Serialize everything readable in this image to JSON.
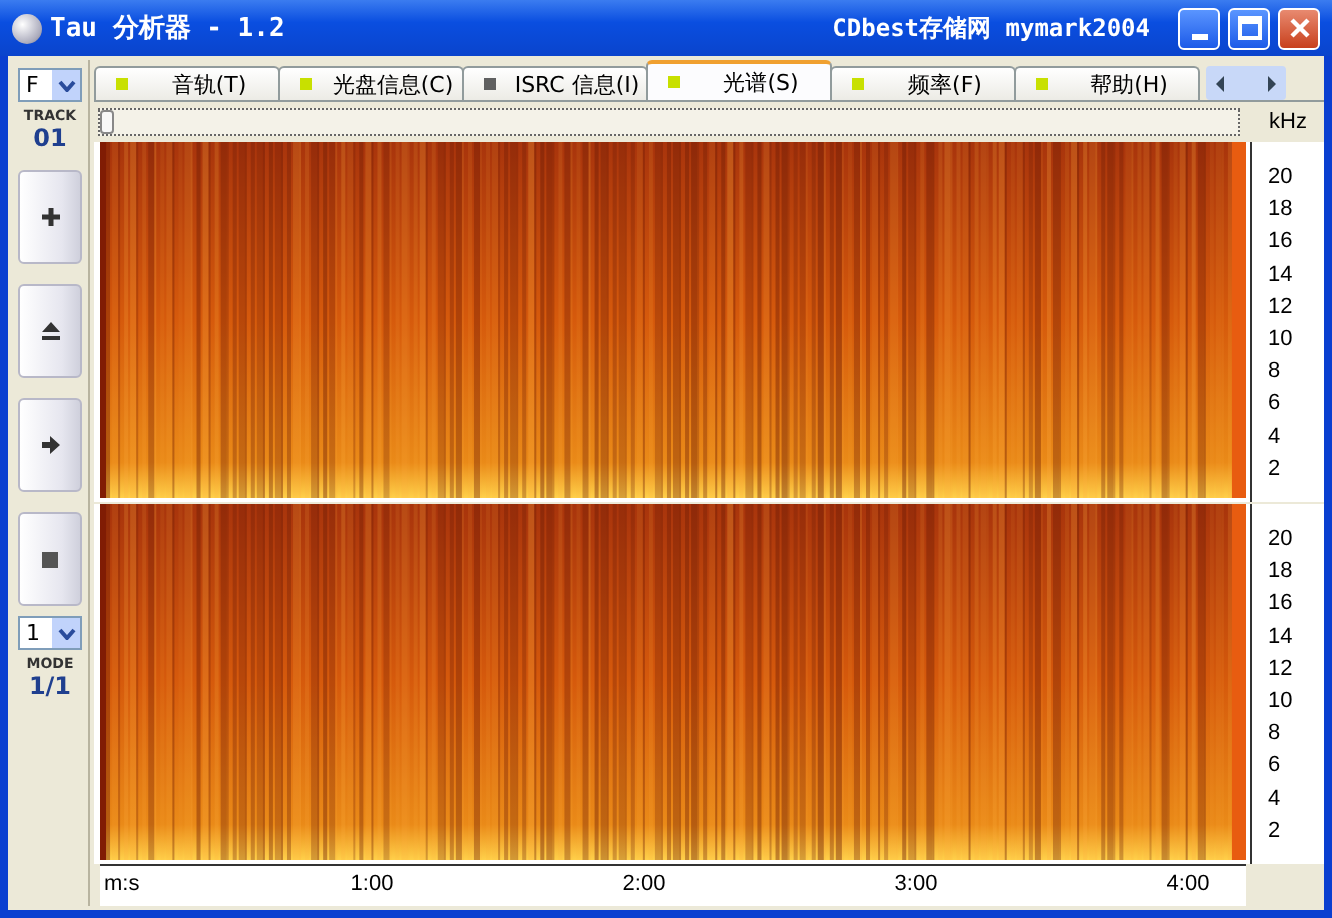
{
  "window": {
    "title": "Tau 分析器 - 1.2",
    "subtitle": "CDbest存储网 mymark2004"
  },
  "left_panel": {
    "drive": "F",
    "track_label": "TRACK",
    "track": "01",
    "mode_select": "1",
    "mode_label": "MODE",
    "mode": "1/1"
  },
  "tabs": [
    {
      "label": "音轨(T)",
      "selected": false,
      "color": "#c8e000"
    },
    {
      "label": "光盘信息(C)",
      "selected": false,
      "color": "#c8e000"
    },
    {
      "label": "ISRC 信息(I)",
      "selected": false,
      "color": "#606060"
    },
    {
      "label": "光谱(S)",
      "selected": true,
      "color": "#c8e000"
    },
    {
      "label": "频率(F)",
      "selected": false,
      "color": "#c8e000"
    },
    {
      "label": "帮助(H)",
      "selected": false,
      "color": "#c8e000"
    }
  ],
  "scrollbar": {
    "level": 0
  },
  "frequency_axis": {
    "unit": "kHz",
    "top_labels": [
      "20",
      "18",
      "16",
      "14",
      "12",
      "10",
      "8",
      "6",
      "4",
      "2"
    ],
    "bottom_labels": [
      "20",
      "18",
      "16",
      "14",
      "12",
      "10",
      "8",
      "6",
      "4",
      "2"
    ]
  },
  "time_axis": {
    "unit": "m:s",
    "labels": [
      "1:00",
      "2:00",
      "3:00",
      "4:00"
    ]
  }
}
